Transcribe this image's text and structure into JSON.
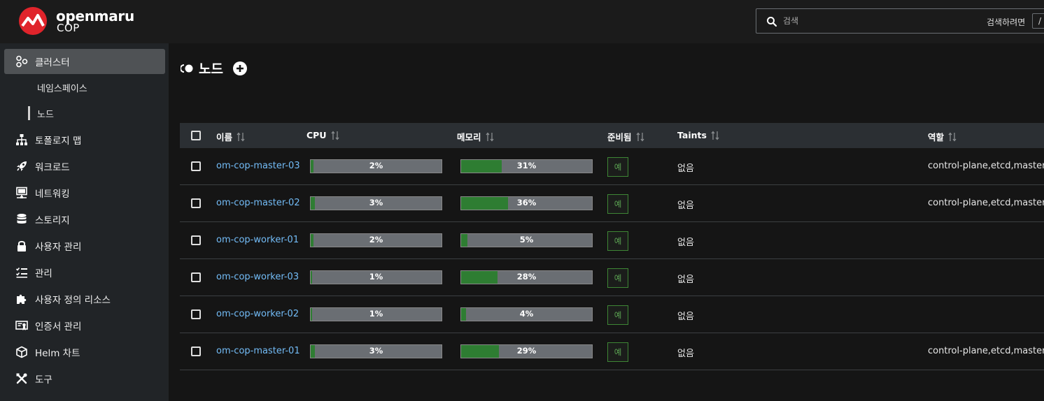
{
  "brand": {
    "name": "openmaru",
    "product": "COP"
  },
  "search": {
    "placeholder": "검색",
    "hint": "검색하려면",
    "shortcut": "/"
  },
  "sidebar": {
    "items": [
      {
        "label": "클러스터",
        "icon": "cluster-icon",
        "active": true
      },
      {
        "label": "토폴로지 맵",
        "icon": "topology-icon"
      },
      {
        "label": "워크로드",
        "icon": "rocket-icon"
      },
      {
        "label": "네트워킹",
        "icon": "network-icon"
      },
      {
        "label": "스토리지",
        "icon": "database-icon"
      },
      {
        "label": "사용자 관리",
        "icon": "lock-icon"
      },
      {
        "label": "관리",
        "icon": "list-check-icon"
      },
      {
        "label": "사용자 정의 리소스",
        "icon": "puzzle-icon"
      },
      {
        "label": "인증서 관리",
        "icon": "certificate-icon"
      },
      {
        "label": "Helm 차트",
        "icon": "cube-icon"
      },
      {
        "label": "도구",
        "icon": "tools-icon"
      }
    ],
    "subitems": [
      {
        "label": "네임스페이스",
        "selected": false
      },
      {
        "label": "노드",
        "selected": true
      }
    ]
  },
  "page": {
    "title": "노드"
  },
  "table": {
    "columns": [
      "이름",
      "CPU",
      "메모리",
      "준비됨",
      "Taints",
      "역할"
    ],
    "rows": [
      {
        "name": "om-cop-master-03",
        "cpu": "2%",
        "cpu_pct": 2,
        "mem": "31%",
        "mem_pct": 31,
        "ready": "예",
        "taints": "없음",
        "role": "control-plane,etcd,master"
      },
      {
        "name": "om-cop-master-02",
        "cpu": "3%",
        "cpu_pct": 3,
        "mem": "36%",
        "mem_pct": 36,
        "ready": "예",
        "taints": "없음",
        "role": "control-plane,etcd,master"
      },
      {
        "name": "om-cop-worker-01",
        "cpu": "2%",
        "cpu_pct": 2,
        "mem": "5%",
        "mem_pct": 5,
        "ready": "예",
        "taints": "없음",
        "role": ""
      },
      {
        "name": "om-cop-worker-03",
        "cpu": "1%",
        "cpu_pct": 1,
        "mem": "28%",
        "mem_pct": 28,
        "ready": "예",
        "taints": "없음",
        "role": ""
      },
      {
        "name": "om-cop-worker-02",
        "cpu": "1%",
        "cpu_pct": 1,
        "mem": "4%",
        "mem_pct": 4,
        "ready": "예",
        "taints": "없음",
        "role": ""
      },
      {
        "name": "om-cop-master-01",
        "cpu": "3%",
        "cpu_pct": 3,
        "mem": "29%",
        "mem_pct": 29,
        "ready": "예",
        "taints": "없음",
        "role": "control-plane,etcd,master"
      }
    ]
  },
  "colors": {
    "accent_green": "#2e7d32",
    "link": "#73bcf7",
    "brand_red": "#e0242b"
  }
}
